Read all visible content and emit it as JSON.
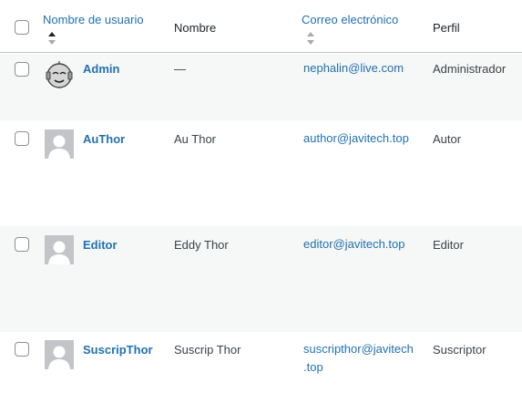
{
  "columns": {
    "username": "Nombre de usuario",
    "name": "Nombre",
    "email": "Correo electrónico",
    "role": "Perfil"
  },
  "users": [
    {
      "username": "Admin",
      "name": "—",
      "email": "nephalin@live.com",
      "email_line2": "",
      "role": "Administrador",
      "avatar": "robot-avatar"
    },
    {
      "username": "AuThor",
      "name": "Au Thor",
      "email": "author@javitech.top",
      "email_line2": "",
      "role": "Autor",
      "avatar": "default-avatar"
    },
    {
      "username": "Editor",
      "name": "Eddy Thor",
      "email": "editor@javitech.top",
      "email_line2": "",
      "role": "Editor",
      "avatar": "default-avatar"
    },
    {
      "username": "SuscripThor",
      "name": "Suscrip Thor",
      "email": "suscripthor@javitech",
      "email_line2": ".top",
      "role": "Suscriptor",
      "avatar": "default-avatar"
    }
  ],
  "colors": {
    "link": "#2271b1",
    "text": "#3c434a",
    "alt_row": "#f6f7f7"
  }
}
